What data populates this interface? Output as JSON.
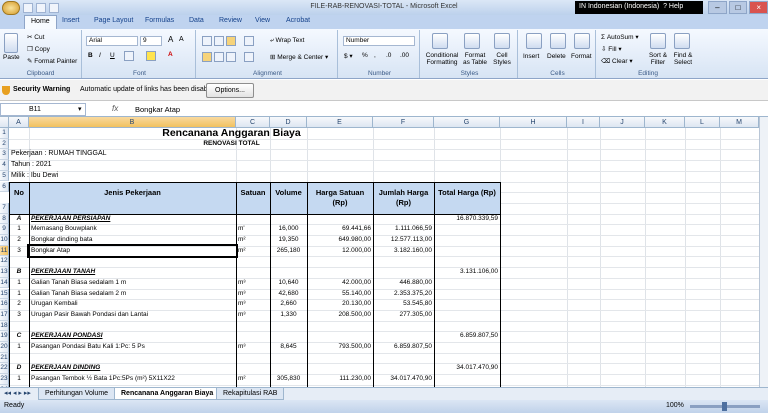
{
  "app": {
    "title": "FILE-RAB-RENOVASI-TOTAL  -  Microsoft Excel",
    "language": "IN Indonesian (Indonesia)",
    "help": "Help"
  },
  "ribbon": {
    "tabs": [
      "Home",
      "Insert",
      "Page Layout",
      "Formulas",
      "Data",
      "Review",
      "View",
      "Acrobat"
    ],
    "clipboard": {
      "paste": "Paste",
      "cut": "Cut",
      "copy": "Copy",
      "format_painter": "Format Painter",
      "label": "Clipboard"
    },
    "font": {
      "name": "Arial",
      "size": "9",
      "label": "Font"
    },
    "alignment": {
      "wrap": "Wrap Text",
      "merge": "Merge & Center",
      "label": "Alignment"
    },
    "number": {
      "format": "Number",
      "label": "Number"
    },
    "styles": {
      "cond": "Conditional Formatting",
      "table": "Format as Table",
      "cell": "Cell Styles",
      "label": "Styles"
    },
    "cells": {
      "insert": "Insert",
      "delete": "Delete",
      "format": "Format",
      "label": "Cells"
    },
    "editing": {
      "autosum": "AutoSum",
      "fill": "Fill",
      "clear": "Clear",
      "sort": "Sort & Filter",
      "find": "Find & Select",
      "label": "Editing"
    }
  },
  "security": {
    "title": "Security Warning",
    "message": "Automatic update of links has been disabled",
    "button": "Options..."
  },
  "formula_bar": {
    "name_box": "B11",
    "fx": "fx",
    "value": "Bongkar Atap"
  },
  "columns": [
    "A",
    "B",
    "C",
    "D",
    "E",
    "F",
    "G",
    "H",
    "I",
    "J",
    "K",
    "L",
    "M"
  ],
  "rows_num": [
    "1",
    "2",
    "3",
    "4",
    "5",
    "6",
    "7",
    "8",
    "9",
    "10",
    "11",
    "12",
    "13",
    "14",
    "15",
    "16",
    "17",
    "18",
    "19",
    "20",
    "21",
    "22",
    "23",
    "24"
  ],
  "sheet": {
    "title": "Rencanana Anggaran Biaya",
    "subtitle": "RENOVASI TOTAL",
    "pekerjaan": "Pekerjaan : RUMAH TINGGAL",
    "tahun": "Tahun : 2021",
    "milik": "Milik : Ibu Dewi",
    "headers": {
      "no": "No",
      "jenis": "Jenis Pekerjaan",
      "satuan": "Satuan",
      "volume": "Volume",
      "harga_satuan": "Harga Satuan (Rp)",
      "jumlah": "Jumlah Harga (Rp)",
      "total": "Total Harga (Rp)"
    },
    "rows": [
      {
        "row": 8,
        "no": "A",
        "jenis": "PEKERJAAN PERSIAPAN",
        "satuan": "",
        "volume": "",
        "harga": "",
        "jumlah": "",
        "total": "16.870.339,59",
        "section": true
      },
      {
        "row": 9,
        "no": "1",
        "jenis": "Memasang Bouwplank",
        "satuan": "m'",
        "volume": "16,000",
        "harga": "69.441,66",
        "jumlah": "1.111.066,59",
        "total": ""
      },
      {
        "row": 10,
        "no": "2",
        "jenis": "Bongkar dinding bata",
        "satuan": "m²",
        "volume": "19,350",
        "harga": "649.980,00",
        "jumlah": "12.577.113,00",
        "total": ""
      },
      {
        "row": 11,
        "no": "3",
        "jenis": "Bongkar Atap",
        "satuan": "m²",
        "volume": "265,180",
        "harga": "12.000,00",
        "jumlah": "3.182.160,00",
        "total": ""
      },
      {
        "row": 12,
        "no": "",
        "jenis": "",
        "satuan": "",
        "volume": "",
        "harga": "",
        "jumlah": "",
        "total": ""
      },
      {
        "row": 13,
        "no": "B",
        "jenis": "PEKERJAAN TANAH",
        "satuan": "",
        "volume": "",
        "harga": "",
        "jumlah": "",
        "total": "3.131.106,00",
        "section": true
      },
      {
        "row": 14,
        "no": "1",
        "jenis": "Galian Tanah Biasa sedalam 1 m",
        "satuan": "m³",
        "volume": "10,640",
        "harga": "42.000,00",
        "jumlah": "446.880,00",
        "total": ""
      },
      {
        "row": 15,
        "no": "1",
        "jenis": "Galian Tanah Biasa sedalam 2 m",
        "satuan": "m³",
        "volume": "42,680",
        "harga": "55.140,00",
        "jumlah": "2.353.375,20",
        "total": ""
      },
      {
        "row": 16,
        "no": "2",
        "jenis": "Urugan Kembali",
        "satuan": "m³",
        "volume": "2,660",
        "harga": "20.130,00",
        "jumlah": "53.545,80",
        "total": ""
      },
      {
        "row": 17,
        "no": "3",
        "jenis": "Urugan Pasir Bawah Pondasi dan Lantai",
        "satuan": "m³",
        "volume": "1,330",
        "harga": "208.500,00",
        "jumlah": "277.305,00",
        "total": ""
      },
      {
        "row": 18,
        "no": "",
        "jenis": "",
        "satuan": "",
        "volume": "",
        "harga": "",
        "jumlah": "",
        "total": ""
      },
      {
        "row": 19,
        "no": "C",
        "jenis": "PEKERJAAN PONDASI",
        "satuan": "",
        "volume": "",
        "harga": "",
        "jumlah": "",
        "total": "6.859.807,50",
        "section": true
      },
      {
        "row": 20,
        "no": "1",
        "jenis": "Pasangan Pondasi Batu Kali 1:Pc: 5 Ps",
        "satuan": "m³",
        "volume": "8,645",
        "harga": "793.500,00",
        "jumlah": "6.859.807,50",
        "total": ""
      },
      {
        "row": 21,
        "no": "",
        "jenis": "",
        "satuan": "",
        "volume": "",
        "harga": "",
        "jumlah": "",
        "total": ""
      },
      {
        "row": 22,
        "no": "D",
        "jenis": "PEKERJAAN DINDING",
        "satuan": "",
        "volume": "",
        "harga": "",
        "jumlah": "",
        "total": "34.017.470,90",
        "section": true
      },
      {
        "row": 23,
        "no": "1",
        "jenis": "Pasangan Tembok ½ Bata 1Pc:5Ps (m²) 5X11X22",
        "satuan": "m²",
        "volume": "305,830",
        "harga": "111.230,00",
        "jumlah": "34.017.470,90",
        "total": ""
      }
    ]
  },
  "sheet_tabs": [
    "Perhitungan Volume",
    "Rencanana Anggaran Biaya",
    "Rekapitulasi RAB"
  ],
  "status": {
    "ready": "Ready",
    "zoom": "100%"
  }
}
